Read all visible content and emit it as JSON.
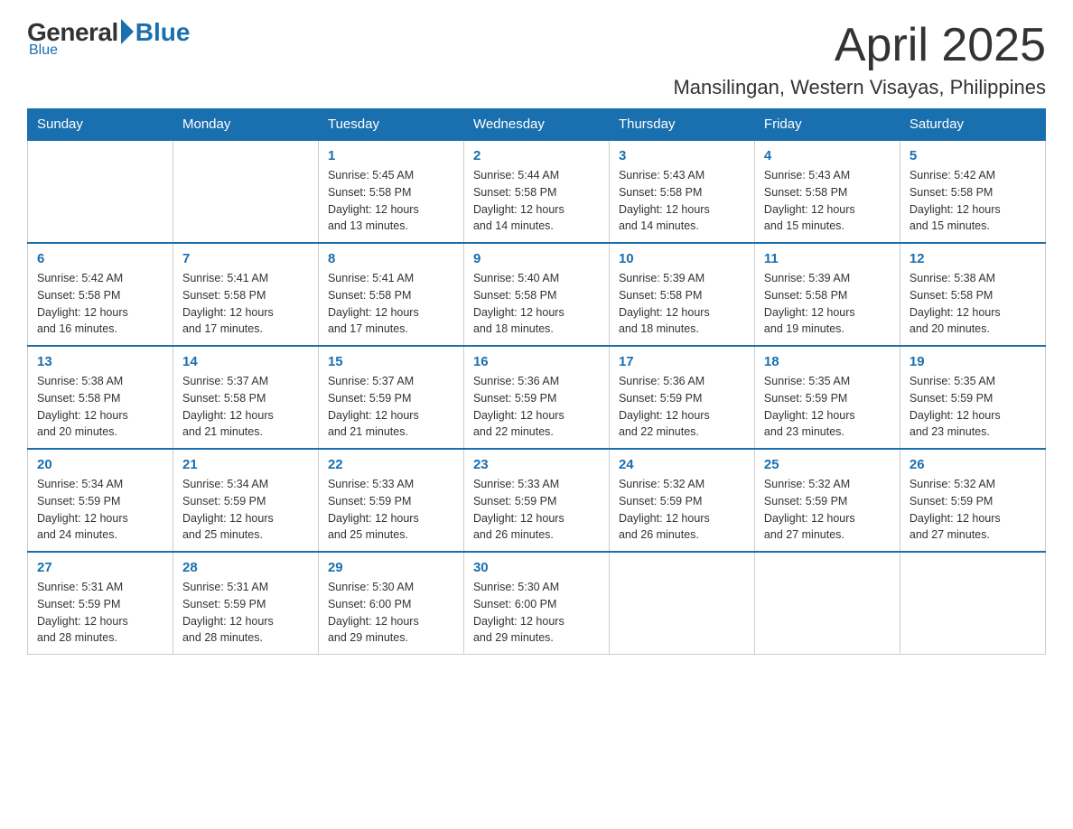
{
  "logo": {
    "general": "General",
    "blue": "Blue"
  },
  "header": {
    "month": "April 2025",
    "location": "Mansilingan, Western Visayas, Philippines"
  },
  "days_of_week": [
    "Sunday",
    "Monday",
    "Tuesday",
    "Wednesday",
    "Thursday",
    "Friday",
    "Saturday"
  ],
  "weeks": [
    [
      {
        "day": "",
        "info": ""
      },
      {
        "day": "",
        "info": ""
      },
      {
        "day": "1",
        "info": "Sunrise: 5:45 AM\nSunset: 5:58 PM\nDaylight: 12 hours\nand 13 minutes."
      },
      {
        "day": "2",
        "info": "Sunrise: 5:44 AM\nSunset: 5:58 PM\nDaylight: 12 hours\nand 14 minutes."
      },
      {
        "day": "3",
        "info": "Sunrise: 5:43 AM\nSunset: 5:58 PM\nDaylight: 12 hours\nand 14 minutes."
      },
      {
        "day": "4",
        "info": "Sunrise: 5:43 AM\nSunset: 5:58 PM\nDaylight: 12 hours\nand 15 minutes."
      },
      {
        "day": "5",
        "info": "Sunrise: 5:42 AM\nSunset: 5:58 PM\nDaylight: 12 hours\nand 15 minutes."
      }
    ],
    [
      {
        "day": "6",
        "info": "Sunrise: 5:42 AM\nSunset: 5:58 PM\nDaylight: 12 hours\nand 16 minutes."
      },
      {
        "day": "7",
        "info": "Sunrise: 5:41 AM\nSunset: 5:58 PM\nDaylight: 12 hours\nand 17 minutes."
      },
      {
        "day": "8",
        "info": "Sunrise: 5:41 AM\nSunset: 5:58 PM\nDaylight: 12 hours\nand 17 minutes."
      },
      {
        "day": "9",
        "info": "Sunrise: 5:40 AM\nSunset: 5:58 PM\nDaylight: 12 hours\nand 18 minutes."
      },
      {
        "day": "10",
        "info": "Sunrise: 5:39 AM\nSunset: 5:58 PM\nDaylight: 12 hours\nand 18 minutes."
      },
      {
        "day": "11",
        "info": "Sunrise: 5:39 AM\nSunset: 5:58 PM\nDaylight: 12 hours\nand 19 minutes."
      },
      {
        "day": "12",
        "info": "Sunrise: 5:38 AM\nSunset: 5:58 PM\nDaylight: 12 hours\nand 20 minutes."
      }
    ],
    [
      {
        "day": "13",
        "info": "Sunrise: 5:38 AM\nSunset: 5:58 PM\nDaylight: 12 hours\nand 20 minutes."
      },
      {
        "day": "14",
        "info": "Sunrise: 5:37 AM\nSunset: 5:58 PM\nDaylight: 12 hours\nand 21 minutes."
      },
      {
        "day": "15",
        "info": "Sunrise: 5:37 AM\nSunset: 5:59 PM\nDaylight: 12 hours\nand 21 minutes."
      },
      {
        "day": "16",
        "info": "Sunrise: 5:36 AM\nSunset: 5:59 PM\nDaylight: 12 hours\nand 22 minutes."
      },
      {
        "day": "17",
        "info": "Sunrise: 5:36 AM\nSunset: 5:59 PM\nDaylight: 12 hours\nand 22 minutes."
      },
      {
        "day": "18",
        "info": "Sunrise: 5:35 AM\nSunset: 5:59 PM\nDaylight: 12 hours\nand 23 minutes."
      },
      {
        "day": "19",
        "info": "Sunrise: 5:35 AM\nSunset: 5:59 PM\nDaylight: 12 hours\nand 23 minutes."
      }
    ],
    [
      {
        "day": "20",
        "info": "Sunrise: 5:34 AM\nSunset: 5:59 PM\nDaylight: 12 hours\nand 24 minutes."
      },
      {
        "day": "21",
        "info": "Sunrise: 5:34 AM\nSunset: 5:59 PM\nDaylight: 12 hours\nand 25 minutes."
      },
      {
        "day": "22",
        "info": "Sunrise: 5:33 AM\nSunset: 5:59 PM\nDaylight: 12 hours\nand 25 minutes."
      },
      {
        "day": "23",
        "info": "Sunrise: 5:33 AM\nSunset: 5:59 PM\nDaylight: 12 hours\nand 26 minutes."
      },
      {
        "day": "24",
        "info": "Sunrise: 5:32 AM\nSunset: 5:59 PM\nDaylight: 12 hours\nand 26 minutes."
      },
      {
        "day": "25",
        "info": "Sunrise: 5:32 AM\nSunset: 5:59 PM\nDaylight: 12 hours\nand 27 minutes."
      },
      {
        "day": "26",
        "info": "Sunrise: 5:32 AM\nSunset: 5:59 PM\nDaylight: 12 hours\nand 27 minutes."
      }
    ],
    [
      {
        "day": "27",
        "info": "Sunrise: 5:31 AM\nSunset: 5:59 PM\nDaylight: 12 hours\nand 28 minutes."
      },
      {
        "day": "28",
        "info": "Sunrise: 5:31 AM\nSunset: 5:59 PM\nDaylight: 12 hours\nand 28 minutes."
      },
      {
        "day": "29",
        "info": "Sunrise: 5:30 AM\nSunset: 6:00 PM\nDaylight: 12 hours\nand 29 minutes."
      },
      {
        "day": "30",
        "info": "Sunrise: 5:30 AM\nSunset: 6:00 PM\nDaylight: 12 hours\nand 29 minutes."
      },
      {
        "day": "",
        "info": ""
      },
      {
        "day": "",
        "info": ""
      },
      {
        "day": "",
        "info": ""
      }
    ]
  ]
}
